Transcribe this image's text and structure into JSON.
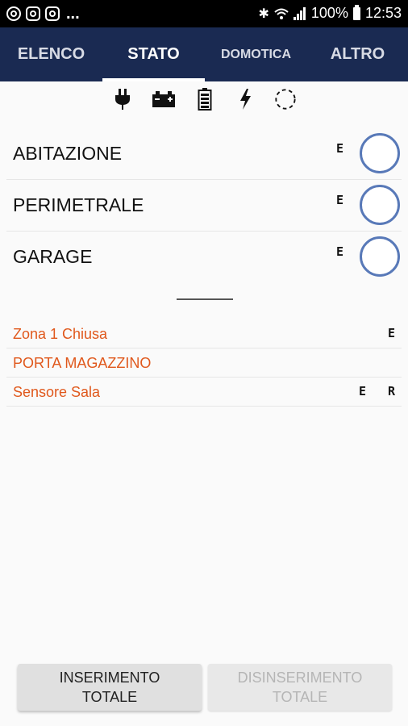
{
  "status_bar": {
    "more": "...",
    "battery_pct": "100%",
    "time": "12:53",
    "icons": [
      "app-icon",
      "instagram-icon",
      "instagram-icon",
      "bluetooth-icon",
      "wifi-icon",
      "signal-icon",
      "battery-icon"
    ]
  },
  "tabs": [
    {
      "label": "ELENCO",
      "active": false
    },
    {
      "label": "STATO",
      "active": true
    },
    {
      "label": "DOMOTICA",
      "active": false
    },
    {
      "label": "ALTRO",
      "active": false
    }
  ],
  "status_icons": [
    "power-plug-icon",
    "car-battery-icon",
    "battery-full-icon",
    "lightning-icon",
    "dotted-circle-icon"
  ],
  "areas": [
    {
      "name": "ABITAZIONE",
      "flag": "E"
    },
    {
      "name": "PERIMETRALE",
      "flag": "E"
    },
    {
      "name": "GARAGE",
      "flag": "E"
    }
  ],
  "zones": [
    {
      "name": "Zona 1 Chiusa",
      "flag1": "",
      "flag2": "E"
    },
    {
      "name": "PORTA MAGAZZINO",
      "flag1": "",
      "flag2": ""
    },
    {
      "name": "Sensore Sala",
      "flag1": "E",
      "flag2": "R"
    }
  ],
  "buttons": {
    "arm": "INSERIMENTO\nTOTALE",
    "disarm": "DISINSERIMENTO\nTOTALE",
    "disarm_enabled": false
  },
  "colors": {
    "tab_bar": "#1a2a52",
    "zone_text": "#e0581c",
    "toggle_ring": "#5879b8"
  }
}
